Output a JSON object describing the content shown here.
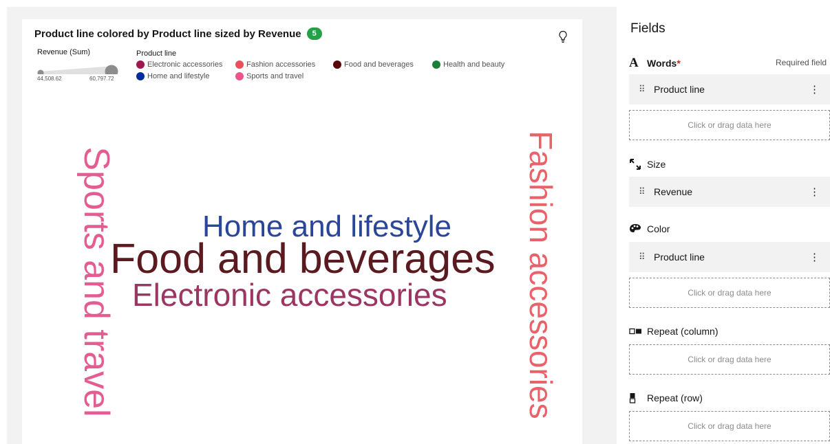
{
  "viz": {
    "title": "Product line colored by Product line sized by Revenue",
    "badge": "5",
    "size_legend": {
      "label": "Revenue (Sum)",
      "min": "44,508.62",
      "max": "60,797.72"
    },
    "color_legend": {
      "label": "Product line",
      "items": [
        {
          "label": "Electronic accessories",
          "color": "#9f1853"
        },
        {
          "label": "Fashion accessories",
          "color": "#e8505b"
        },
        {
          "label": "Food and beverages",
          "color": "#570408"
        },
        {
          "label": "Health and beauty",
          "color": "#198038"
        },
        {
          "label": "Home and lifestyle",
          "color": "#002d9c"
        },
        {
          "label": "Sports and travel",
          "color": "#ee538b"
        }
      ]
    },
    "words": [
      {
        "text": "Food and beverages",
        "color": "#5a1a1f"
      },
      {
        "text": "Home and lifestyle",
        "color": "#2b4699"
      },
      {
        "text": "Electronic accessories",
        "color": "#9b3562"
      },
      {
        "text": "Sports and travel",
        "color": "#e45d92"
      },
      {
        "text": "Fashion accessories",
        "color": "#e8626a"
      }
    ]
  },
  "panel": {
    "title": "Fields",
    "words": {
      "label": "Words",
      "required_mark": "*",
      "required_text": "Required field",
      "field": "Product line",
      "drop": "Click or drag data here"
    },
    "size": {
      "label": "Size",
      "field": "Revenue"
    },
    "color": {
      "label": "Color",
      "field": "Product line",
      "drop": "Click or drag data here"
    },
    "repeat_column": {
      "label": "Repeat (column)",
      "drop": "Click or drag data here"
    },
    "repeat_row": {
      "label": "Repeat (row)",
      "drop": "Click or drag data here"
    },
    "icons": {
      "grip": "drag-handle-icon",
      "kebab": "overflow-menu-icon"
    }
  }
}
